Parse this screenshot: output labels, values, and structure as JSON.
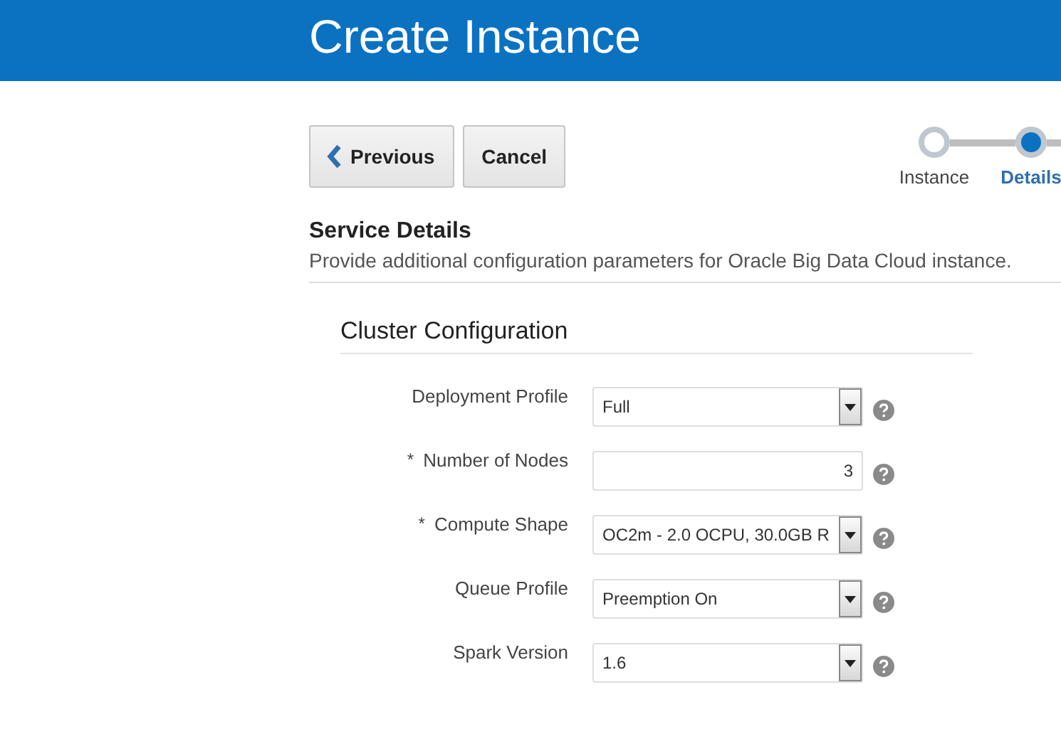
{
  "header": {
    "title": "Create Instance"
  },
  "buttons": [
    {
      "label": "Previous",
      "kind": "back"
    },
    {
      "label": "Cancel",
      "kind": "plain"
    }
  ],
  "steps": [
    {
      "label": "Instance",
      "selected": false
    },
    {
      "label": "Details",
      "selected": true
    }
  ],
  "section": {
    "title": "Service Details",
    "description": "Provide additional configuration parameters for Oracle Big Data Cloud instance."
  },
  "group": {
    "title": "Cluster Configuration"
  },
  "fields": [
    {
      "label": "Deployment Profile",
      "kind": "select",
      "value": "Full"
    },
    {
      "label": "Number of Nodes",
      "required_mark": "*",
      "kind": "number",
      "value": "3"
    },
    {
      "label": "Compute Shape",
      "required_mark": "*",
      "kind": "select",
      "value": "OC2m - 2.0 OCPU, 30.0GB R"
    },
    {
      "label": "Queue Profile",
      "kind": "select",
      "value": "Preemption On"
    },
    {
      "label": "Spark Version",
      "kind": "select",
      "value": "1.6"
    }
  ]
}
